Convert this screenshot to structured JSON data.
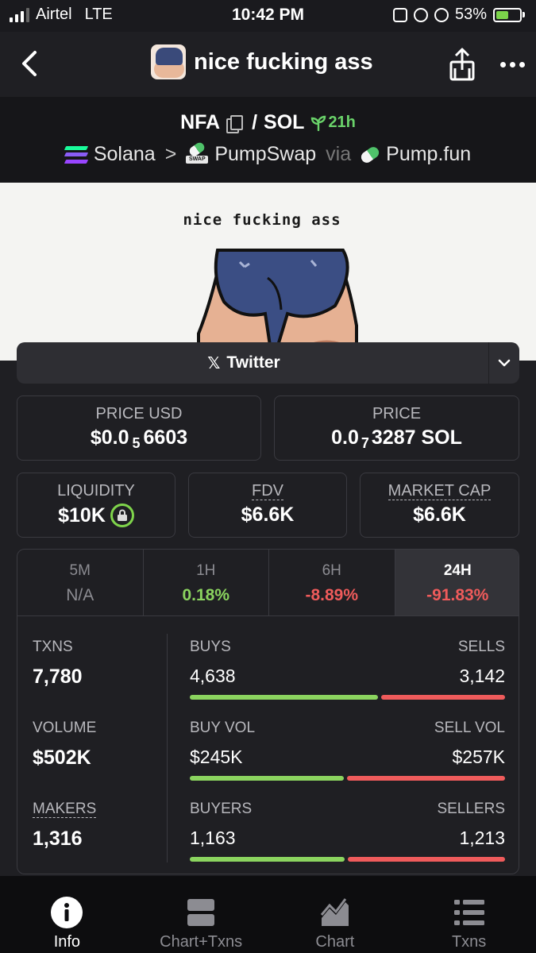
{
  "status_bar": {
    "carrier": "Airtel",
    "network": "LTE",
    "time": "10:42 PM",
    "battery": "53%",
    "battery_level": 0.53
  },
  "header": {
    "title": "nice fucking ass"
  },
  "pair": {
    "base": "NFA",
    "separator": "/",
    "quote": "SOL",
    "age": "21h",
    "chain": "Solana",
    "dex": "PumpSwap",
    "via_label": "via",
    "launchpad": "Pump.fun"
  },
  "banner": {
    "text": "nice fucking ass"
  },
  "twitter": {
    "label": "Twitter"
  },
  "metrics": {
    "price_usd_label": "PRICE USD",
    "price_usd_prefix": "$0.0",
    "price_usd_zeros": "5",
    "price_usd_digits": "6603",
    "price_label": "PRICE",
    "price_prefix": "0.0",
    "price_zeros": "7",
    "price_digits": "3287 SOL",
    "liquidity_label": "LIQUIDITY",
    "liquidity_value": "$10K",
    "fdv_label": "FDV",
    "fdv_value": "$6.6K",
    "mcap_label": "MARKET CAP",
    "mcap_value": "$6.6K"
  },
  "timeframes": [
    {
      "label": "5M",
      "value": "N/A"
    },
    {
      "label": "1H",
      "value": "0.18%"
    },
    {
      "label": "6H",
      "value": "-8.89%"
    },
    {
      "label": "24H",
      "value": "-91.83%"
    }
  ],
  "stats": {
    "txns_label": "TXNS",
    "txns_value": "7,780",
    "buys_label": "BUYS",
    "buys_value": "4,638",
    "sells_label": "SELLS",
    "sells_value": "3,142",
    "buys_fraction": 0.596,
    "volume_label": "VOLUME",
    "volume_value": "$502K",
    "buy_vol_label": "BUY VOL",
    "buy_vol_value": "$245K",
    "sell_vol_label": "SELL VOL",
    "sell_vol_value": "$257K",
    "buy_vol_fraction": 0.488,
    "makers_label": "MAKERS",
    "makers_value": "1,316",
    "buyers_label": "BUYERS",
    "buyers_value": "1,163",
    "sellers_label": "SELLERS",
    "sellers_value": "1,213",
    "buyers_fraction": 0.49
  },
  "nav": [
    {
      "label": "Info",
      "icon": "info-icon"
    },
    {
      "label": "Chart+Txns",
      "icon": "chart-txns-icon"
    },
    {
      "label": "Chart",
      "icon": "chart-icon"
    },
    {
      "label": "Txns",
      "icon": "txns-icon"
    }
  ],
  "colors": {
    "positive": "#8bd45f",
    "negative": "#ef5b5b",
    "background": "#1f1f23"
  }
}
